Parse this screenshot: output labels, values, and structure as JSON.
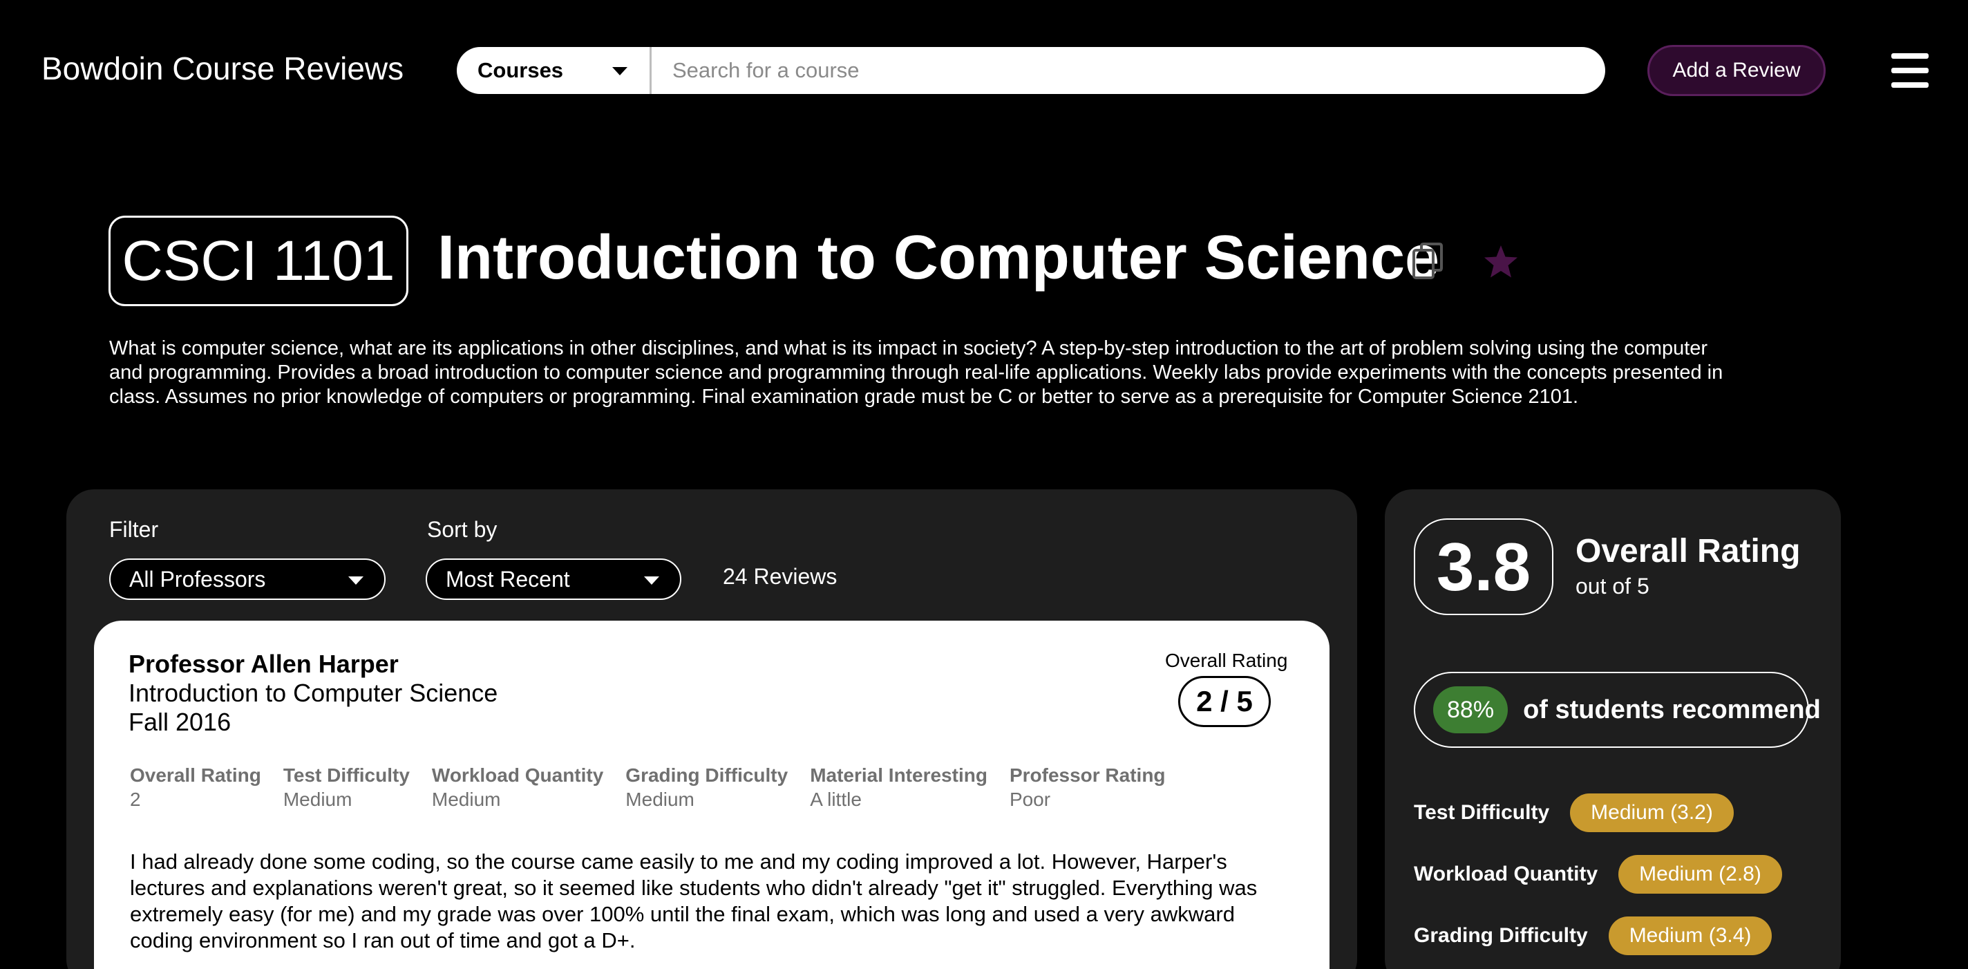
{
  "header": {
    "site_title": "Bowdoin Course Reviews",
    "search_category": "Courses",
    "search_placeholder": "Search for a course",
    "add_review_label": "Add a Review"
  },
  "course": {
    "code": "CSCI 1101",
    "name": "Introduction to Computer Science",
    "description": "What is computer science, what are its applications in other disciplines, and what is its impact in society? A step-by-step introduction to the art of problem solving using the computer and programming. Provides a broad introduction to computer science and programming through real-life applications. Weekly labs provide experiments with the concepts presented in class. Assumes no prior knowledge of computers or programming. Final examination grade must be C or better to serve as a prerequisite for Computer Science 2101."
  },
  "icons": {
    "copy": "copy-icon",
    "favorite": "star-icon",
    "menu": "hamburger-menu-icon",
    "favorite_color": "#4a1448"
  },
  "reviews": {
    "filter_label": "Filter",
    "filter_value": "All Professors",
    "sort_label": "Sort by",
    "sort_value": "Most Recent",
    "count_text": "24 Reviews",
    "items": [
      {
        "professor": "Professor Allen Harper",
        "course": "Introduction to Computer Science",
        "term": "Fall 2016",
        "overall_label": "Overall Rating",
        "overall_value": "2 / 5",
        "metrics": [
          {
            "label": "Overall Rating",
            "value": "2"
          },
          {
            "label": "Test Difficulty",
            "value": "Medium"
          },
          {
            "label": "Workload Quantity",
            "value": "Medium"
          },
          {
            "label": "Grading Difficulty",
            "value": "Medium"
          },
          {
            "label": "Material Interesting",
            "value": "A little"
          },
          {
            "label": "Professor Rating",
            "value": "Poor"
          }
        ],
        "text": "I had already done some coding, so the course came easily to me and my coding improved a lot. However, Harper's lectures and explanations weren't great, so it seemed like students who didn't already \"get it\" struggled. Everything was extremely easy (for me) and my grade was over 100% until the final exam, which was long and used a very awkward coding environment so I ran out of time and got a D+."
      }
    ]
  },
  "summary": {
    "overall_value": "3.8",
    "overall_label": "Overall Rating",
    "out_of": "out of 5",
    "recommend_pct": "88%",
    "recommend_text": "of students recommend",
    "stats": [
      {
        "label": "Test Difficulty",
        "value": "Medium (3.2)"
      },
      {
        "label": "Workload Quantity",
        "value": "Medium (2.8)"
      },
      {
        "label": "Grading Difficulty",
        "value": "Medium (3.4)"
      }
    ]
  },
  "colors": {
    "background": "#000000",
    "panel": "#1e1e1e",
    "add_review_bg": "#2e0a2e",
    "recommend_green": "#3d7e32",
    "badge_gold": "#c99a2e"
  }
}
